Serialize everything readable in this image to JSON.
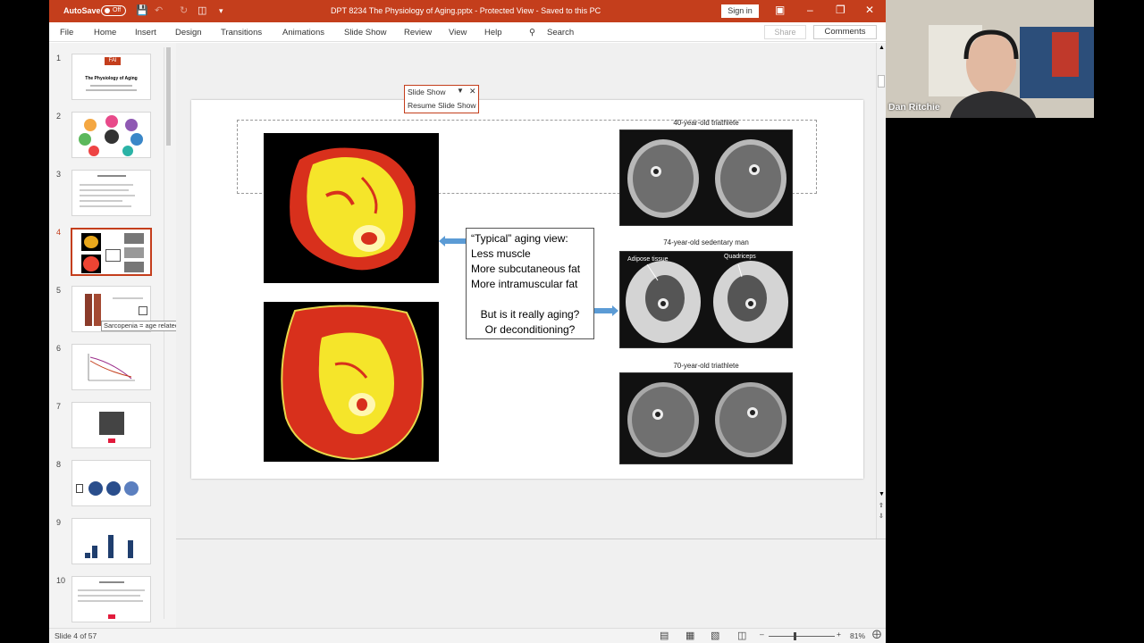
{
  "titlebar": {
    "autosave_label": "AutoSave",
    "autosave_state": "Off",
    "document_title": "DPT 8234 The Physiology of Aging.pptx  -  Protected View  -  Saved to this PC",
    "signin_label": "Sign in"
  },
  "menu": {
    "items": [
      "File",
      "Home",
      "Insert",
      "Design",
      "Transitions",
      "Animations",
      "Slide Show",
      "Review",
      "View",
      "Help"
    ],
    "search_label": "Search",
    "share_label": "Share",
    "comments_label": "Comments"
  },
  "thumbnails": {
    "numbers": [
      "1",
      "2",
      "3",
      "4",
      "5",
      "6",
      "7",
      "8",
      "9",
      "10"
    ],
    "active_index": 4,
    "thumb1_brand": "FAI",
    "thumb1_title": "The Physiology of Aging",
    "tooltip": "Sarcopenia = age related declin..."
  },
  "slide": {
    "callout": {
      "line1": "“Typical” aging view:",
      "line2": "Less muscle",
      "line3": "More subcutaneous fat",
      "line4": "More intramuscular fat",
      "line5": "But is it really aging?",
      "line6": "Or deconditioning?"
    },
    "scans": {
      "cap1": "40-year-old triathlete",
      "cap2": "74-year-old sedentary man",
      "label_adipose": "Adipose tissue",
      "label_quadriceps": "Quadriceps",
      "cap3": "70-year-old triathlete"
    }
  },
  "popup": {
    "title": "Slide Show",
    "resume": "Resume Slide Show"
  },
  "status": {
    "slide_info": "Slide 4 of 57",
    "zoom": "81%"
  },
  "webcam": {
    "name": "Dan Ritchie"
  },
  "colors": {
    "accent": "#c43e1c",
    "arrow": "#5b9bd5"
  }
}
